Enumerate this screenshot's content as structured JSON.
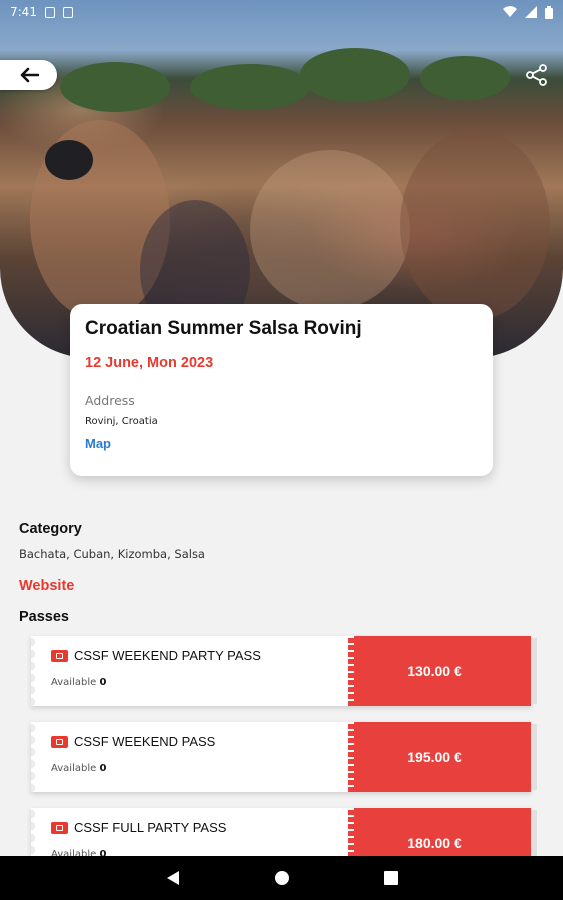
{
  "status_bar": {
    "time": "7:41"
  },
  "event": {
    "title": "Croatian Summer Salsa Rovinj",
    "date": "12 June, Mon 2023",
    "address_label": "Address",
    "address_value": "Rovinj, Croatia",
    "map_label": "Map"
  },
  "category": {
    "heading": "Category",
    "value": "Bachata, Cuban, Kizomba, Salsa"
  },
  "website_label": "Website",
  "passes_heading": "Passes",
  "passes": [
    {
      "name": "CSSF WEEKEND PARTY PASS",
      "available_label": "Available",
      "available_count": "0",
      "price": "130.00 €"
    },
    {
      "name": "CSSF WEEKEND PASS",
      "available_label": "Available",
      "available_count": "0",
      "price": "195.00 €"
    },
    {
      "name": "CSSF FULL PARTY PASS",
      "available_label": "Available",
      "available_count": "0",
      "price": "180.00 €"
    }
  ],
  "colors": {
    "accent": "#e8392f",
    "link": "#2a7bd3",
    "background": "#f2f2f2"
  },
  "icons": {
    "back": "arrow-left-icon",
    "share": "share-icon",
    "ticket": "ticket-icon"
  }
}
